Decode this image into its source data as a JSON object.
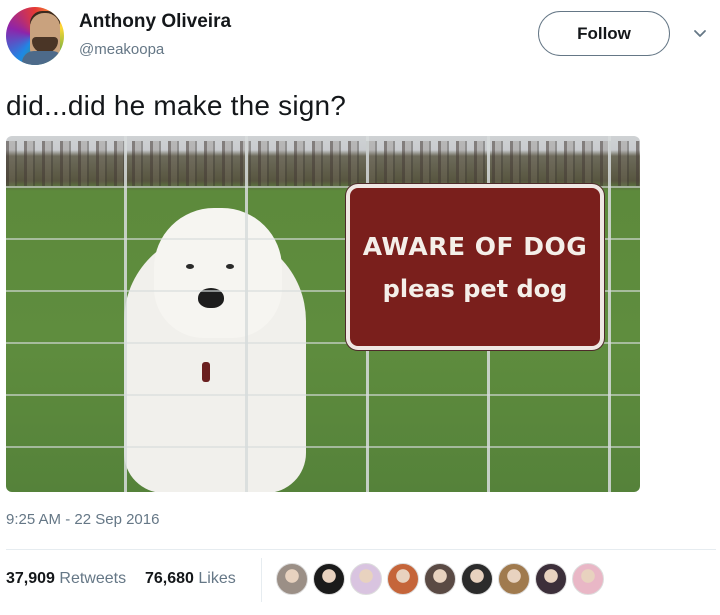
{
  "author": {
    "name": "Anthony Oliveira",
    "handle": "@meakoopa"
  },
  "follow_label": "Follow",
  "tweet_text": "did...did he make the sign?",
  "image": {
    "sign_line1": "AWARE OF DOG",
    "sign_line2": "pleas pet dog"
  },
  "timestamp": "9:25 AM - 22 Sep 2016",
  "stats": {
    "retweets_count": "37,909",
    "retweets_label": "Retweets",
    "likes_count": "76,680",
    "likes_label": "Likes"
  },
  "likers": [
    {
      "color": "#9b8f86"
    },
    {
      "color": "#1a1a1a"
    },
    {
      "color": "#d9c4e0"
    },
    {
      "color": "#c5653a"
    },
    {
      "color": "#5a4a44"
    },
    {
      "color": "#2b2b2b"
    },
    {
      "color": "#a07a4e"
    },
    {
      "color": "#3c2f3a"
    },
    {
      "color": "#e9b7c6"
    }
  ],
  "colors": {
    "accent_text": "#14171a",
    "secondary_text": "#657786",
    "sign_red": "#7a1f1c"
  }
}
